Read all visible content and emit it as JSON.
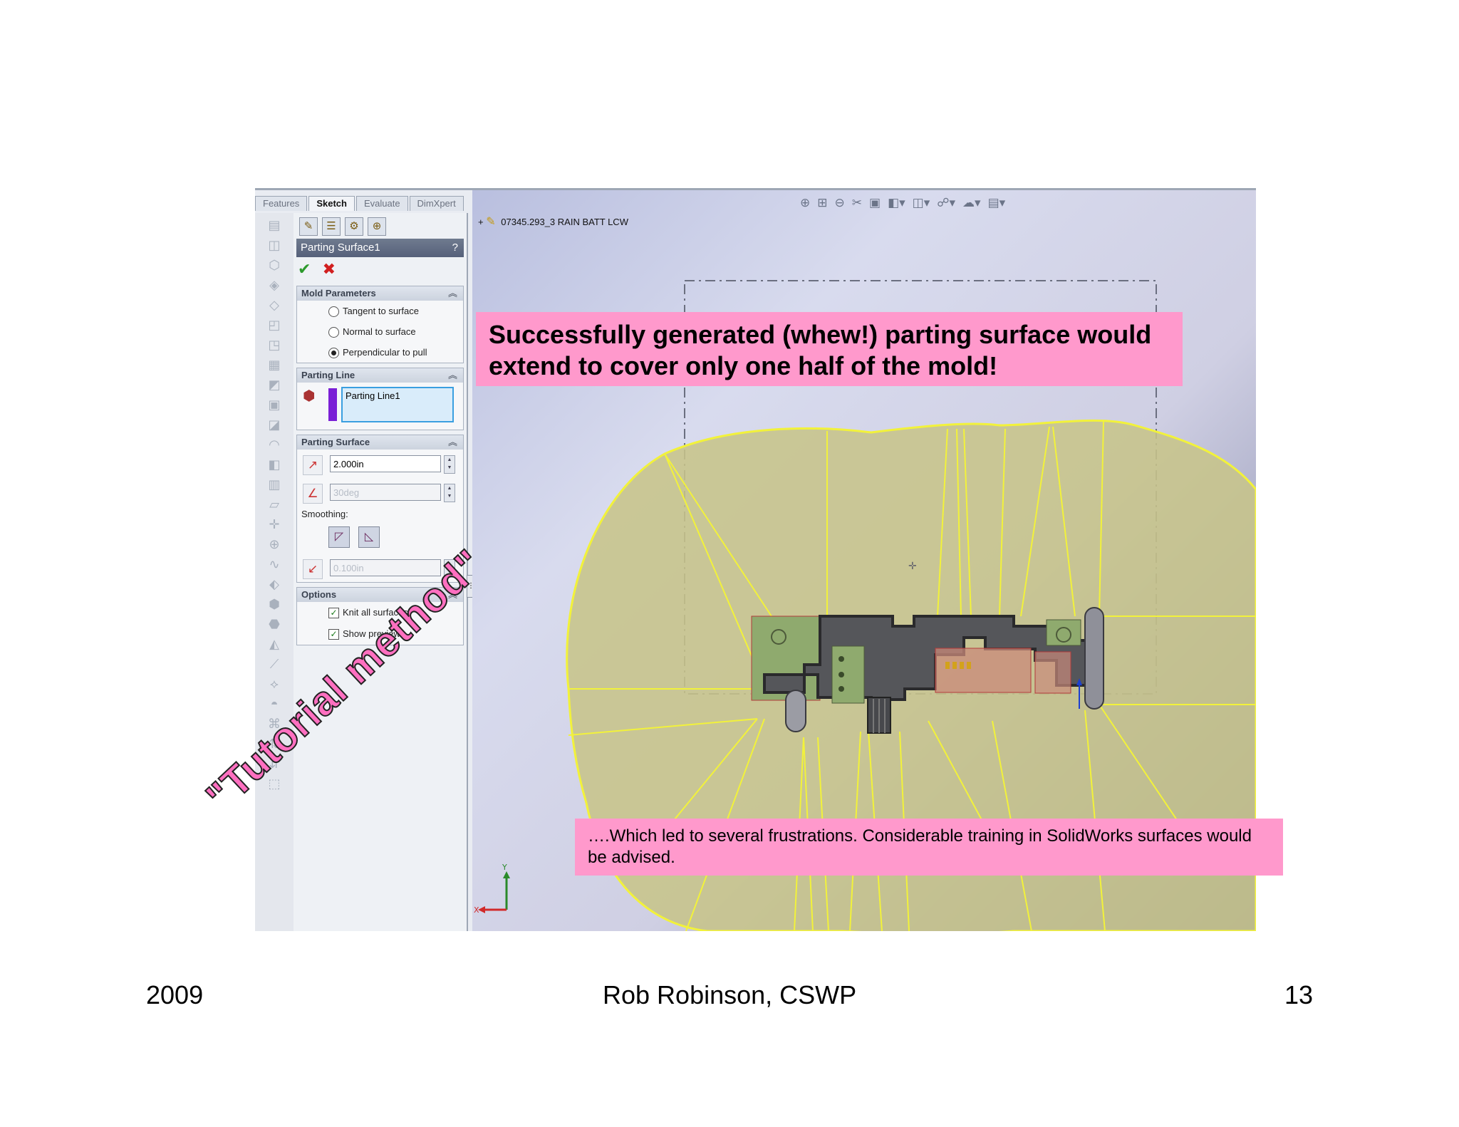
{
  "tabs": [
    "Features",
    "Sketch",
    "Evaluate",
    "DimXpert"
  ],
  "property_manager": {
    "title": "Parting Surface1",
    "help": "?",
    "ok": "✔",
    "cancel": "✖",
    "mold_parameters": {
      "header": "Mold Parameters",
      "options": [
        "Tangent to surface",
        "Normal to surface",
        "Perpendicular to pull"
      ],
      "selected": "Perpendicular to pull"
    },
    "parting_line": {
      "header": "Parting Line",
      "item": "Parting Line1"
    },
    "parting_surface": {
      "header": "Parting Surface",
      "distance": "2.000in",
      "angle": "30deg",
      "smoothing_label": "Smoothing:",
      "smoothing_distance": "0.100in"
    },
    "options": {
      "header": "Options",
      "knit_all_surfaces": "Knit all surfaces",
      "show_preview": "Show preview"
    }
  },
  "viewport": {
    "tree_item": "07345.293_3 RAIN BATT LCW",
    "axis_x": "X",
    "axis_y": "Y"
  },
  "annotations": {
    "callout_top": "Successfully generated (whew!) parting surface would extend to cover only one half of the mold!",
    "callout_bottom": "….Which led to several frustrations. Considerable training in SolidWorks surfaces would be advised.",
    "stamp": "\"Tutorial method\""
  },
  "footer": {
    "year": "2009",
    "author": "Rob Robinson, CSWP",
    "page": "13"
  },
  "colors": {
    "callout_bg": "#ff99cc",
    "surface_fill": "#c7c48a",
    "surface_edge": "#f2f23a",
    "stamp": "#ff6fc0"
  }
}
